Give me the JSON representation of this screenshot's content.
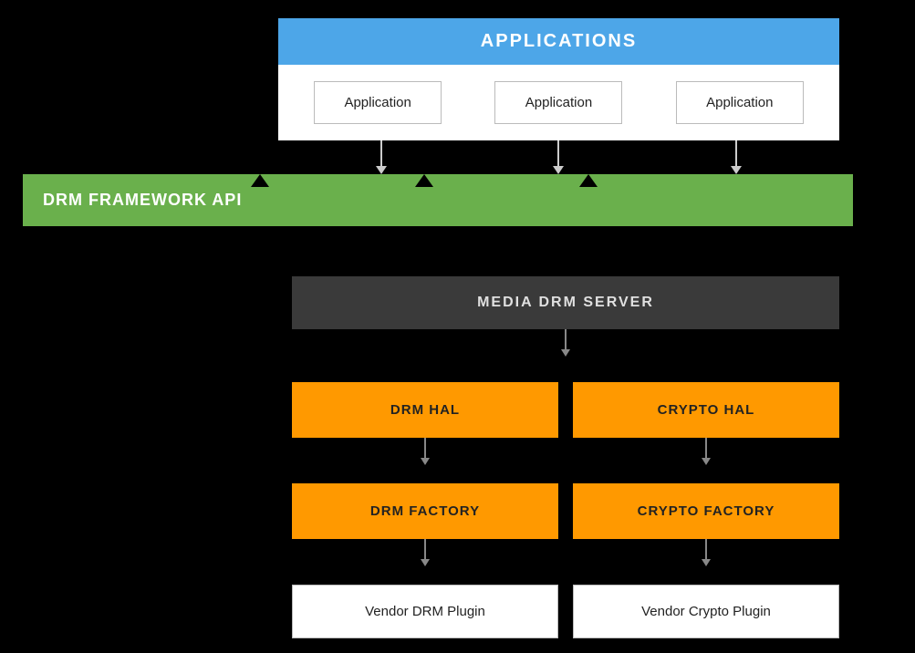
{
  "diagram": {
    "applications_header": "APPLICATIONS",
    "app_boxes": [
      "Application",
      "Application",
      "Application"
    ],
    "drm_framework_label": "DRM FRAMEWORK API",
    "media_drm_server_label": "MEDIA DRM SERVER",
    "hal_boxes": [
      "DRM HAL",
      "CRYPTO HAL"
    ],
    "factory_boxes": [
      "DRM FACTORY",
      "CRYPTO FACTORY"
    ],
    "vendor_boxes": [
      "Vendor DRM Plugin",
      "Vendor Crypto Plugin"
    ],
    "colors": {
      "applications_bg": "#4da6e8",
      "drm_framework_bg": "#6ab04c",
      "media_drm_server_bg": "#3a3a3a",
      "hal_bg": "#ffaa00",
      "factory_bg": "#ffaa00",
      "vendor_bg": "#ffffff"
    }
  }
}
